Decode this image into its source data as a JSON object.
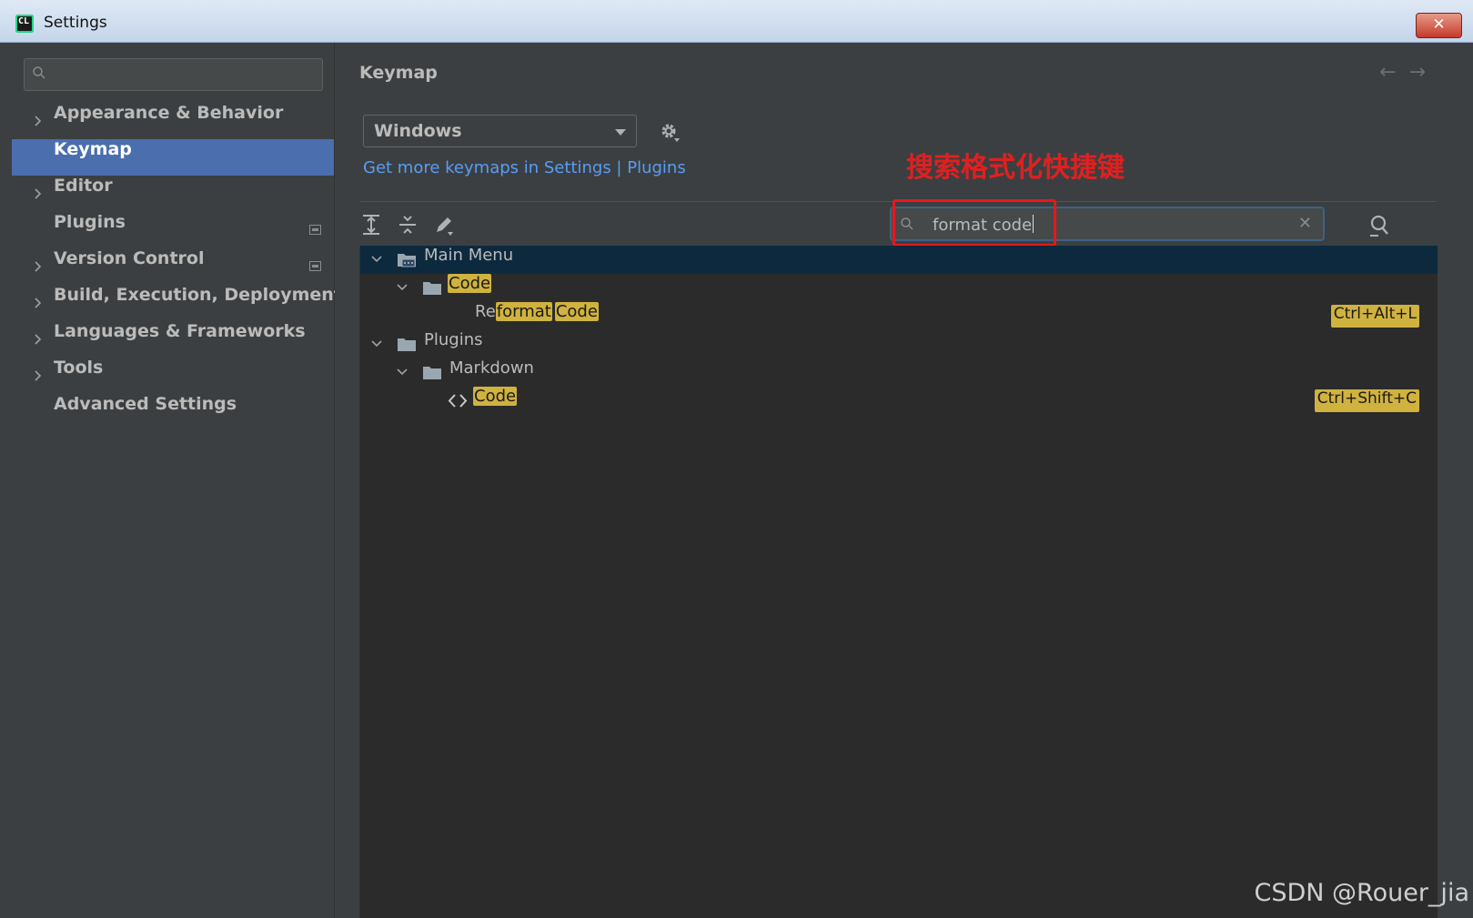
{
  "window": {
    "title": "Settings",
    "app_icon_text": "CL",
    "close_label": "✕"
  },
  "sidebar": {
    "search_placeholder": "",
    "items": [
      {
        "label": "Appearance & Behavior",
        "expandable": true,
        "selected": false,
        "badge": false
      },
      {
        "label": "Keymap",
        "expandable": false,
        "selected": true,
        "badge": false
      },
      {
        "label": "Editor",
        "expandable": true,
        "selected": false,
        "badge": false
      },
      {
        "label": "Plugins",
        "expandable": false,
        "selected": false,
        "badge": true
      },
      {
        "label": "Version Control",
        "expandable": true,
        "selected": false,
        "badge": true
      },
      {
        "label": "Build, Execution, Deployment",
        "expandable": true,
        "selected": false,
        "badge": false
      },
      {
        "label": "Languages & Frameworks",
        "expandable": true,
        "selected": false,
        "badge": false
      },
      {
        "label": "Tools",
        "expandable": true,
        "selected": false,
        "badge": false
      },
      {
        "label": "Advanced Settings",
        "expandable": false,
        "selected": false,
        "badge": false
      }
    ]
  },
  "main": {
    "title": "Keymap",
    "back_arrow": "←",
    "forward_arrow": "→",
    "keymap_select": {
      "value": "Windows"
    },
    "link_text": "Get more keymaps in Settings | Plugins",
    "annotation": "搜索格式化快捷键",
    "search": {
      "value": "format code",
      "clear": "✕"
    },
    "tree": {
      "main_menu": "Main Menu",
      "code_folder": "Code",
      "reformat_prefix": "Re",
      "reformat_hl1": "format",
      "reformat_hl2": "Code",
      "reformat_shortcut": "Ctrl+Alt+L",
      "plugins": "Plugins",
      "markdown": "Markdown",
      "md_code": "Code",
      "md_code_shortcut": "Ctrl+Shift+C"
    }
  },
  "watermark": "CSDN @Rouer_jia",
  "colors": {
    "selection": "#4b6eaf",
    "tree_selection": "#0d293e",
    "highlight": "#d0b23f",
    "link": "#589df6",
    "annotation": "#e02020"
  }
}
